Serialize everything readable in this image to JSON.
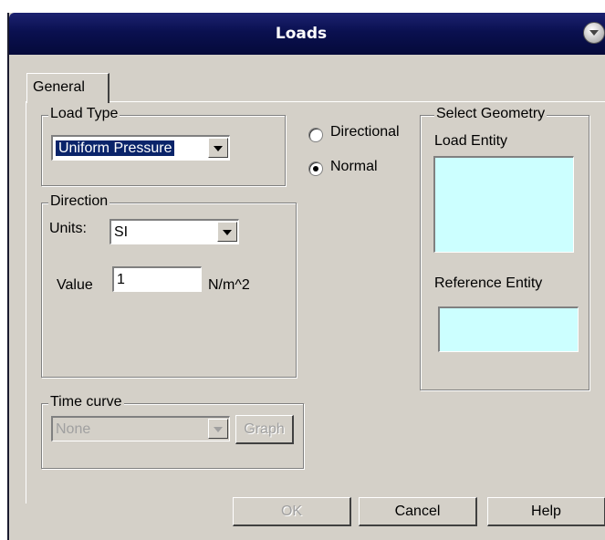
{
  "window": {
    "title": "Loads"
  },
  "tabs": [
    {
      "label": "General"
    }
  ],
  "load_type": {
    "legend": "Load Type",
    "selected": "Uniform Pressure"
  },
  "orientation": {
    "directional_label": "Directional",
    "normal_label": "Normal",
    "selected": "Normal"
  },
  "direction": {
    "legend": "Direction",
    "units_label": "Units:",
    "units_value": "SI",
    "value_label": "Value",
    "value": "1",
    "value_unit": "N/m^2"
  },
  "time_curve": {
    "legend": "Time curve",
    "selected": "None",
    "graph_label": "Graph"
  },
  "select_geometry": {
    "legend": "Select Geometry",
    "load_entity_label": "Load Entity",
    "reference_entity_label": "Reference Entity"
  },
  "buttons": {
    "ok": "OK",
    "cancel": "Cancel",
    "help": "Help"
  }
}
